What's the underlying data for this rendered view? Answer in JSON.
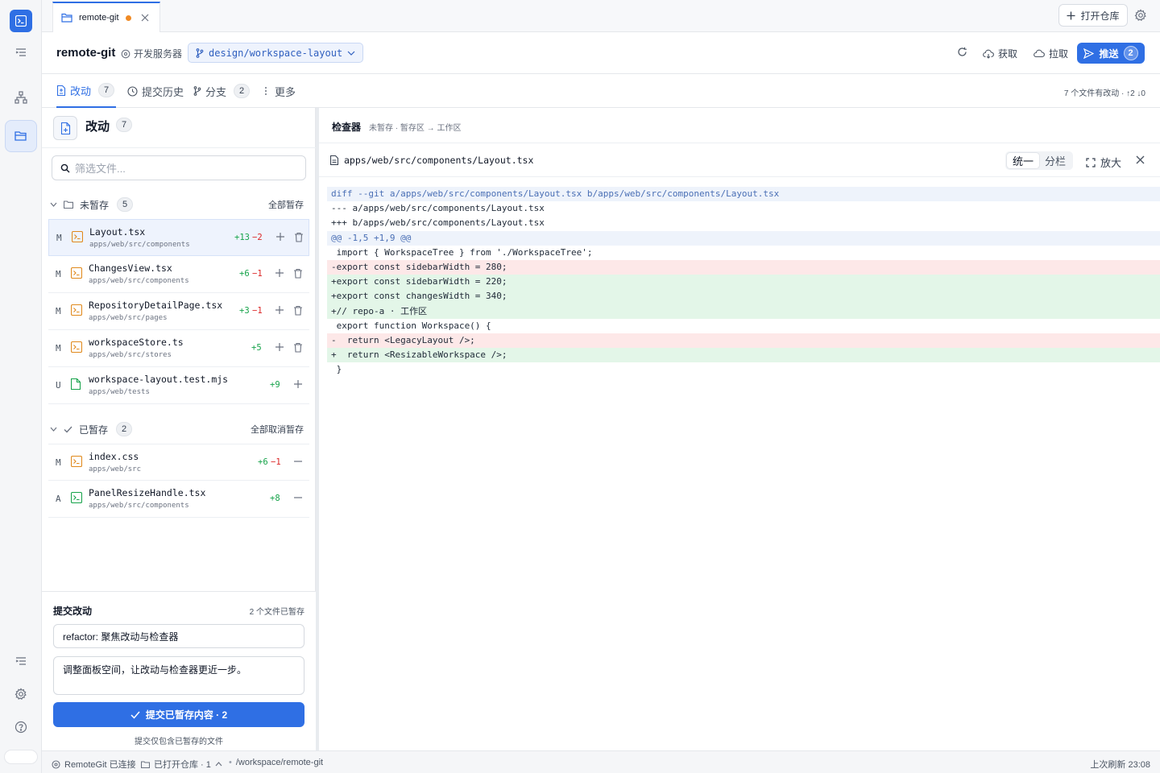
{
  "tabs": [
    {
      "label": "remote-git",
      "modified": true
    }
  ],
  "topbar": {
    "open_repo_label": "打开仓库"
  },
  "header": {
    "repo_name": "remote-git",
    "server_label": "开发服务器",
    "branch": "design/workspace-layout",
    "fetch_label": "获取",
    "pull_label": "拉取",
    "push_label": "推送",
    "push_count": "2"
  },
  "nav": {
    "tabs": [
      {
        "label": "改动",
        "count": "7"
      },
      {
        "label": "提交历史"
      },
      {
        "label": "分支",
        "count": "2"
      },
      {
        "label": "更多"
      }
    ],
    "summary": "7 个文件有改动 · ↑2 ↓0"
  },
  "changes": {
    "title": "改动",
    "count": "7",
    "filter_placeholder": "筛选文件...",
    "unstaged": {
      "label": "未暂存",
      "count": "5",
      "action": "全部暂存",
      "files": [
        {
          "status": "M",
          "name": "Layout.tsx",
          "path": "apps/web/src/components",
          "add": "+13",
          "del": "−2"
        },
        {
          "status": "M",
          "name": "ChangesView.tsx",
          "path": "apps/web/src/components",
          "add": "+6",
          "del": "−1"
        },
        {
          "status": "M",
          "name": "RepositoryDetailPage.tsx",
          "path": "apps/web/src/pages",
          "add": "+3",
          "del": "−1"
        },
        {
          "status": "M",
          "name": "workspaceStore.ts",
          "path": "apps/web/src/stores",
          "add": "+5",
          "del": ""
        },
        {
          "status": "U",
          "name": "workspace-layout.test.mjs",
          "path": "apps/web/tests",
          "add": "+9",
          "del": ""
        }
      ]
    },
    "staged": {
      "label": "已暂存",
      "count": "2",
      "action": "全部取消暂存",
      "files": [
        {
          "status": "M",
          "name": "index.css",
          "path": "apps/web/src",
          "add": "+6",
          "del": "−1"
        },
        {
          "status": "A",
          "name": "PanelResizeHandle.tsx",
          "path": "apps/web/src/components",
          "add": "+8",
          "del": ""
        }
      ]
    }
  },
  "commit": {
    "title": "提交改动",
    "staged_info": "2 个文件已暂存",
    "summary": "refactor: 聚焦改动与检查器",
    "description": "调整面板空间，让改动与检查器更近一步。",
    "button": "提交已暂存内容 · 2",
    "note": "提交仅包含已暂存的文件"
  },
  "inspector": {
    "title": "检查器",
    "subtitle": "未暂存 · 暂存区 → 工作区",
    "file_path": "apps/web/src/components/Layout.tsx",
    "view_unified": "统一",
    "view_split": "分栏",
    "zoom_label": "放大",
    "diff_lines": [
      {
        "type": "meta",
        "text": "diff --git a/apps/web/src/components/Layout.tsx b/apps/web/src/components/Layout.tsx"
      },
      {
        "type": "ctx",
        "text": "--- a/apps/web/src/components/Layout.tsx"
      },
      {
        "type": "ctx",
        "text": "+++ b/apps/web/src/components/Layout.tsx"
      },
      {
        "type": "hunk",
        "text": "@@ -1,5 +1,9 @@"
      },
      {
        "type": "ctx",
        "text": " import { WorkspaceTree } from './WorkspaceTree';"
      },
      {
        "type": "rem",
        "text": "-export const sidebarWidth = 280;"
      },
      {
        "type": "add",
        "text": "+export const sidebarWidth = 220;"
      },
      {
        "type": "add",
        "text": "+export const changesWidth = 340;"
      },
      {
        "type": "add",
        "text": "+// repo-a · 工作区"
      },
      {
        "type": "ctx",
        "text": " export function Workspace() {"
      },
      {
        "type": "rem",
        "text": "-  return <LegacyLayout />;"
      },
      {
        "type": "add",
        "text": "+  return <ResizableWorkspace />;"
      },
      {
        "type": "ctx",
        "text": " }"
      }
    ]
  },
  "statusbar": {
    "connection": "RemoteGit 已连接",
    "opened": "已打开仓库 · 1",
    "path": "/workspace/remote-git",
    "last_refresh": "上次刷新 23:08"
  },
  "colors": {
    "accent": "#2f6fe4",
    "added": "#16a34a",
    "removed": "#dc2626",
    "modified_dot": "#f08a24"
  }
}
